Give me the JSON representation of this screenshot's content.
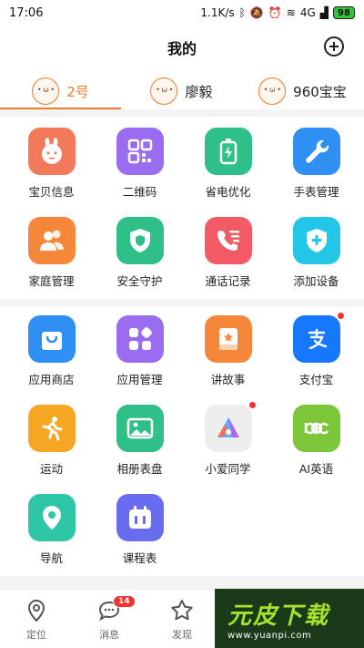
{
  "status_bar": {
    "time": "17:06",
    "speed": "1.1K/s",
    "network": "4G",
    "battery": "98"
  },
  "header": {
    "title": "我的"
  },
  "profiles": [
    {
      "name": "2号",
      "active": true
    },
    {
      "name": "廖毅",
      "active": false
    },
    {
      "name": "960宝宝",
      "active": false
    }
  ],
  "section1": [
    {
      "label": "宝贝信息",
      "icon": "bunny-face-icon",
      "color": "#f2795a"
    },
    {
      "label": "二维码",
      "icon": "qr-code-icon",
      "color": "#9a6cf0"
    },
    {
      "label": "省电优化",
      "icon": "battery-bolt-icon",
      "color": "#2fc08a"
    },
    {
      "label": "手表管理",
      "icon": "wrench-icon",
      "color": "#2f8ff2"
    },
    {
      "label": "家庭管理",
      "icon": "family-icon",
      "color": "#f5873a"
    },
    {
      "label": "安全守护",
      "icon": "shield-icon",
      "color": "#2fc08a"
    },
    {
      "label": "通话记录",
      "icon": "phone-list-icon",
      "color": "#f25a66"
    },
    {
      "label": "添加设备",
      "icon": "add-device-icon",
      "color": "#24c6e8"
    }
  ],
  "section2": [
    {
      "label": "应用商店",
      "icon": "store-bag-icon",
      "color": "#2f8ff2",
      "dot": false
    },
    {
      "label": "应用管理",
      "icon": "apps-grid-icon",
      "color": "#9a6cf0",
      "dot": false
    },
    {
      "label": "讲故事",
      "icon": "story-book-icon",
      "color": "#f5873a",
      "dot": false
    },
    {
      "label": "支付宝",
      "icon": "alipay-icon",
      "color": "#1677ff",
      "dot": true
    },
    {
      "label": "运动",
      "icon": "running-icon",
      "color": "#f5a623",
      "dot": false
    },
    {
      "label": "相册表盘",
      "icon": "photo-icon",
      "color": "#2fc08a",
      "dot": false
    },
    {
      "label": "小爱同学",
      "icon": "xiaoai-icon",
      "color": "#eeeeee",
      "dot": true
    },
    {
      "label": "AI英语",
      "icon": "abc-icon",
      "color": "#7cc63a",
      "dot": false
    },
    {
      "label": "导航",
      "icon": "location-pin-icon",
      "color": "#2fc6a8",
      "dot": false
    },
    {
      "label": "课程表",
      "icon": "calendar-icon",
      "color": "#6a6cf0",
      "dot": false
    }
  ],
  "bottom_nav": [
    {
      "label": "定位",
      "icon": "location-icon"
    },
    {
      "label": "消息",
      "icon": "chat-icon",
      "badge": "14"
    },
    {
      "label": "发现",
      "icon": "star-icon"
    }
  ],
  "watermark": {
    "logo": "元皮下载",
    "url": "www.yuanpi.com"
  }
}
